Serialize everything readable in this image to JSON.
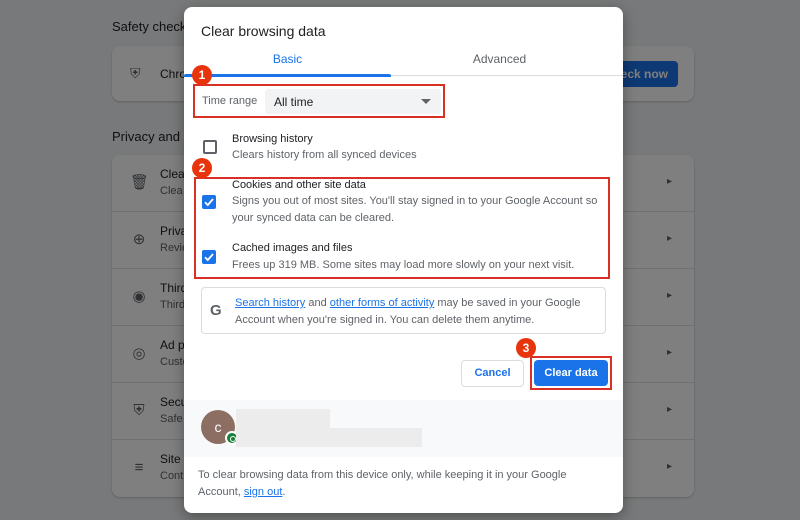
{
  "background": {
    "section_safety": "Safety check",
    "safety_row_text": "Chro",
    "check_now_label": "eck now",
    "section_privacy": "Privacy and s",
    "rows": [
      {
        "icon": "trash-icon",
        "title": "Clea",
        "subtitle": "Clea"
      },
      {
        "icon": "privacy-guide-icon",
        "title": "Priva",
        "subtitle": "Revie"
      },
      {
        "icon": "cookie-icon",
        "title": "Third",
        "subtitle": "Third"
      },
      {
        "icon": "ad-privacy-icon",
        "title": "Ad p",
        "subtitle": "Custo"
      },
      {
        "icon": "security-shield-icon",
        "title": "Secu",
        "subtitle": "Safe"
      },
      {
        "icon": "site-settings-icon",
        "title": "Site s",
        "subtitle": "Cont"
      }
    ]
  },
  "dialog": {
    "title": "Clear browsing data",
    "tabs": [
      {
        "label": "Basic",
        "active": true
      },
      {
        "label": "Advanced",
        "active": false
      }
    ],
    "time_range": {
      "label": "Time range",
      "value": "All time"
    },
    "items": [
      {
        "title": "Browsing history",
        "desc": "Clears history from all synced devices",
        "checked": false
      },
      {
        "title": "Cookies and other site data",
        "desc": "Signs you out of most sites. You'll stay signed in to your Google Account so your synced data can be cleared.",
        "checked": true
      },
      {
        "title": "Cached images and files",
        "desc": "Frees up 319 MB. Some sites may load more slowly on your next visit.",
        "checked": true
      }
    ],
    "google_note": {
      "link1": "Search history",
      "and": " and ",
      "link2": "other forms of activity",
      "rest": " may be saved in your Google Account when you're signed in. You can delete them anytime."
    },
    "cancel_label": "Cancel",
    "clear_label": "Clear data",
    "avatar_letter": "c",
    "footer_text": "To clear browsing data from this device only, while keeping it in your Google Account, ",
    "footer_link": "sign out",
    "footer_end": "."
  },
  "markers": [
    "1",
    "2",
    "3"
  ],
  "colors": {
    "accent": "#1a73e8",
    "annotation_red": "#d93025",
    "marker_red": "#e8340c",
    "sync_green": "#188038"
  }
}
